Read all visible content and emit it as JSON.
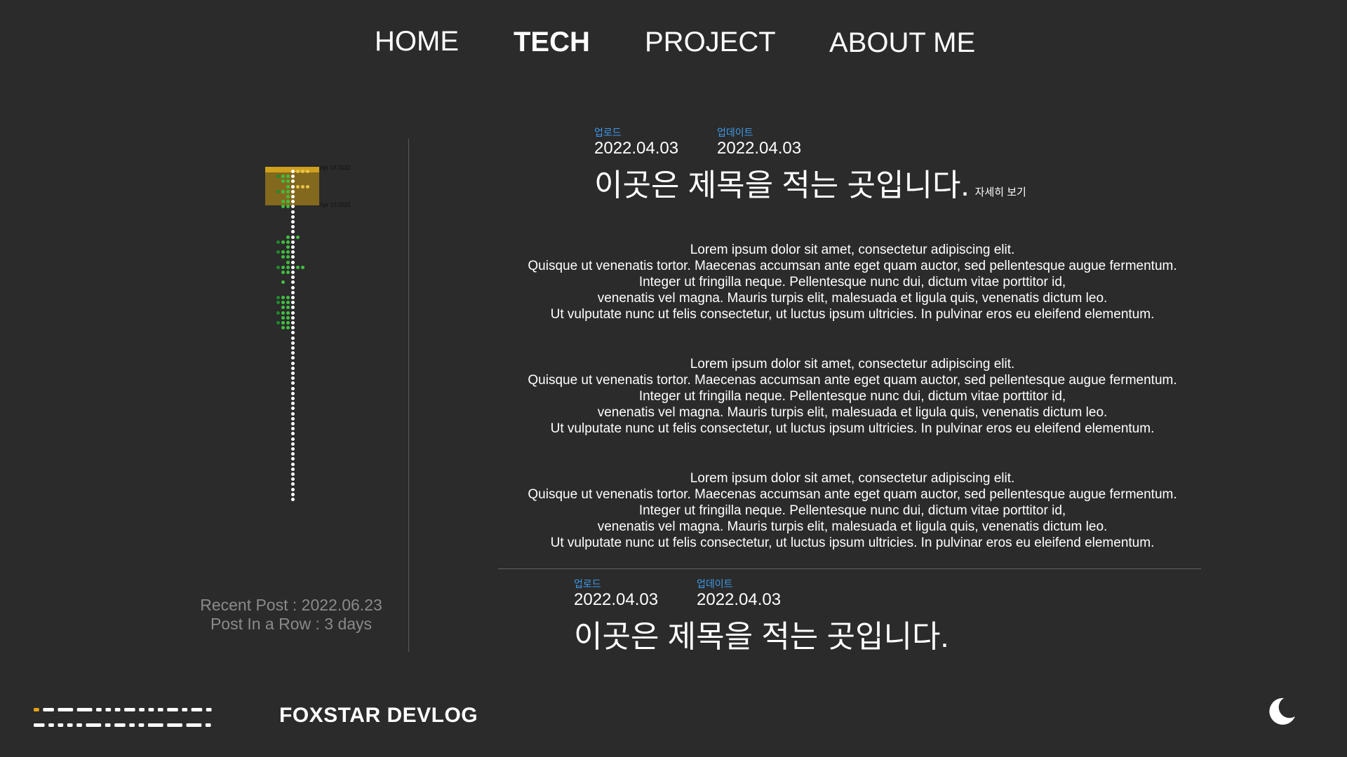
{
  "nav": {
    "items": [
      {
        "label": "HOME"
      },
      {
        "label": "TECH"
      },
      {
        "label": "PROJECT"
      },
      {
        "label": "ABOUT ME"
      }
    ]
  },
  "activity": {
    "range_start_label": "Apr 03 2022",
    "range_end_label": "Apr 10 2022",
    "recent_post": "Recent Post : 2022.06.23",
    "post_in_a_row": "Post In a Row : 3 days",
    "colors": {
      "highlight": "#cfa01c",
      "highlight_dot": "#e8c34a",
      "active": "#3fbf3f",
      "dark_active": "#1f8a2e",
      "empty": "#ffffff"
    }
  },
  "posts": [
    {
      "upload_label": "업로드",
      "upload_date": "2022.04.03",
      "update_label": "업데이트",
      "update_date": "2022.04.03",
      "title": "이곳은 제목을 적는 곳입니다.",
      "detail_link": "자세히 보기",
      "paragraphs": [
        [
          "Lorem ipsum dolor sit amet, consectetur adipiscing elit.",
          "Quisque ut venenatis tortor. Maecenas accumsan ante eget quam auctor, sed pellentesque augue fermentum.",
          "Integer ut fringilla neque. Pellentesque nunc dui, dictum vitae porttitor id,",
          "venenatis vel magna. Mauris turpis elit, malesuada et ligula quis, venenatis dictum leo.",
          "Ut vulputate nunc ut felis consectetur, ut luctus ipsum ultricies. In pulvinar eros eu eleifend elementum."
        ],
        [
          "Lorem ipsum dolor sit amet, consectetur adipiscing elit.",
          "Quisque ut venenatis tortor. Maecenas accumsan ante eget quam auctor, sed pellentesque augue fermentum.",
          "Integer ut fringilla neque. Pellentesque nunc dui, dictum vitae porttitor id,",
          "venenatis vel magna. Mauris turpis elit, malesuada et ligula quis, venenatis dictum leo.",
          "Ut vulputate nunc ut felis consectetur, ut luctus ipsum ultricies. In pulvinar eros eu eleifend elementum."
        ],
        [
          "Lorem ipsum dolor sit amet, consectetur adipiscing elit.",
          "Quisque ut venenatis tortor. Maecenas accumsan ante eget quam auctor, sed pellentesque augue fermentum.",
          "Integer ut fringilla neque. Pellentesque nunc dui, dictum vitae porttitor id,",
          "venenatis vel magna. Mauris turpis elit, malesuada et ligula quis, venenatis dictum leo.",
          "Ut vulputate nunc ut felis consectetur, ut luctus ipsum ultricies. In pulvinar eros eu eleifend elementum."
        ]
      ]
    },
    {
      "upload_label": "업로드",
      "upload_date": "2022.04.03",
      "update_label": "업데이트",
      "update_date": "2022.04.03",
      "title": "이곳은 제목을 적는 곳입니다."
    }
  ],
  "footer": {
    "brand": "FOXSTAR  DEVLOG",
    "theme_toggle_icon": "moon-icon",
    "logo_accent": "#e8a317"
  }
}
